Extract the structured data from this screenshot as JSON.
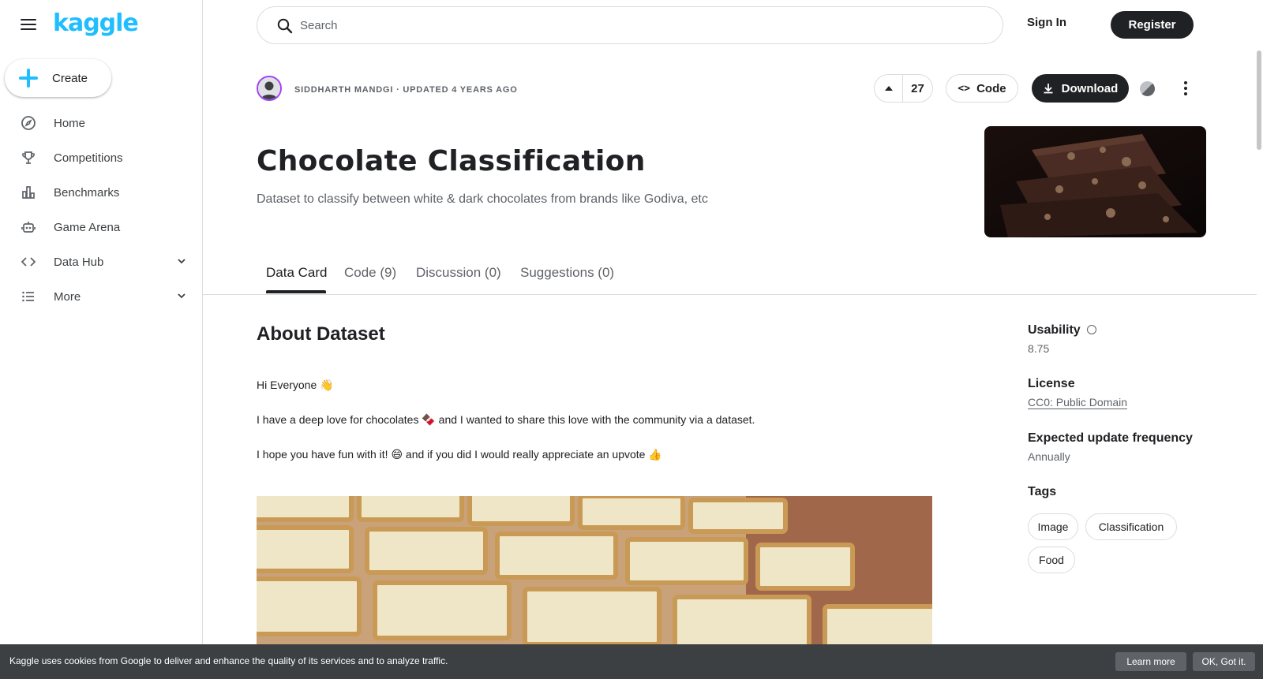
{
  "brand": {
    "logo_text": "kaggle",
    "accent": "#20beff"
  },
  "sidebar": {
    "create_label": "Create",
    "items": [
      {
        "label": "Home",
        "icon": "compass-icon"
      },
      {
        "label": "Competitions",
        "icon": "trophy-icon"
      },
      {
        "label": "Benchmarks",
        "icon": "bar-chart-icon"
      },
      {
        "label": "Game Arena",
        "icon": "robot-icon"
      },
      {
        "label": "Data Hub",
        "icon": "code-brackets-icon",
        "expandable": true
      },
      {
        "label": "More",
        "icon": "list-icon",
        "expandable": true
      }
    ]
  },
  "header": {
    "search_placeholder": "Search",
    "signin_label": "Sign In",
    "register_label": "Register"
  },
  "dataset": {
    "byline": "SIDDHARTH MANDGI · UPDATED 4 YEARS AGO",
    "votes": "27",
    "code_label": "Code",
    "download_label": "Download",
    "title": "Chocolate Classification",
    "subtitle": "Dataset to classify between white & dark chocolates from brands like Godiva, etc"
  },
  "tabs": [
    {
      "label": "Data Card",
      "active": true
    },
    {
      "label": "Code (9)"
    },
    {
      "label": "Discussion (0)"
    },
    {
      "label": "Suggestions (0)"
    }
  ],
  "about": {
    "heading": "About Dataset",
    "paragraphs": [
      "Hi Everyone 👋",
      "I have a deep love for chocolates 🍫 and I wanted to share this love with the community via a dataset.",
      "I hope you have fun with it! 😄 and if you did I would really appreciate an upvote 👍"
    ]
  },
  "meta": {
    "usability_label": "Usability",
    "usability_value": "8.75",
    "license_label": "License",
    "license_value": "CC0: Public Domain",
    "frequency_label": "Expected update frequency",
    "frequency_value": "Annually",
    "tags_label": "Tags",
    "tags": [
      "Image",
      "Classification",
      "Food"
    ]
  },
  "cookie": {
    "text": "Kaggle uses cookies from Google to deliver and enhance the quality of its services and to analyze traffic.",
    "learn_more": "Learn more",
    "ok": "OK, Got it."
  }
}
